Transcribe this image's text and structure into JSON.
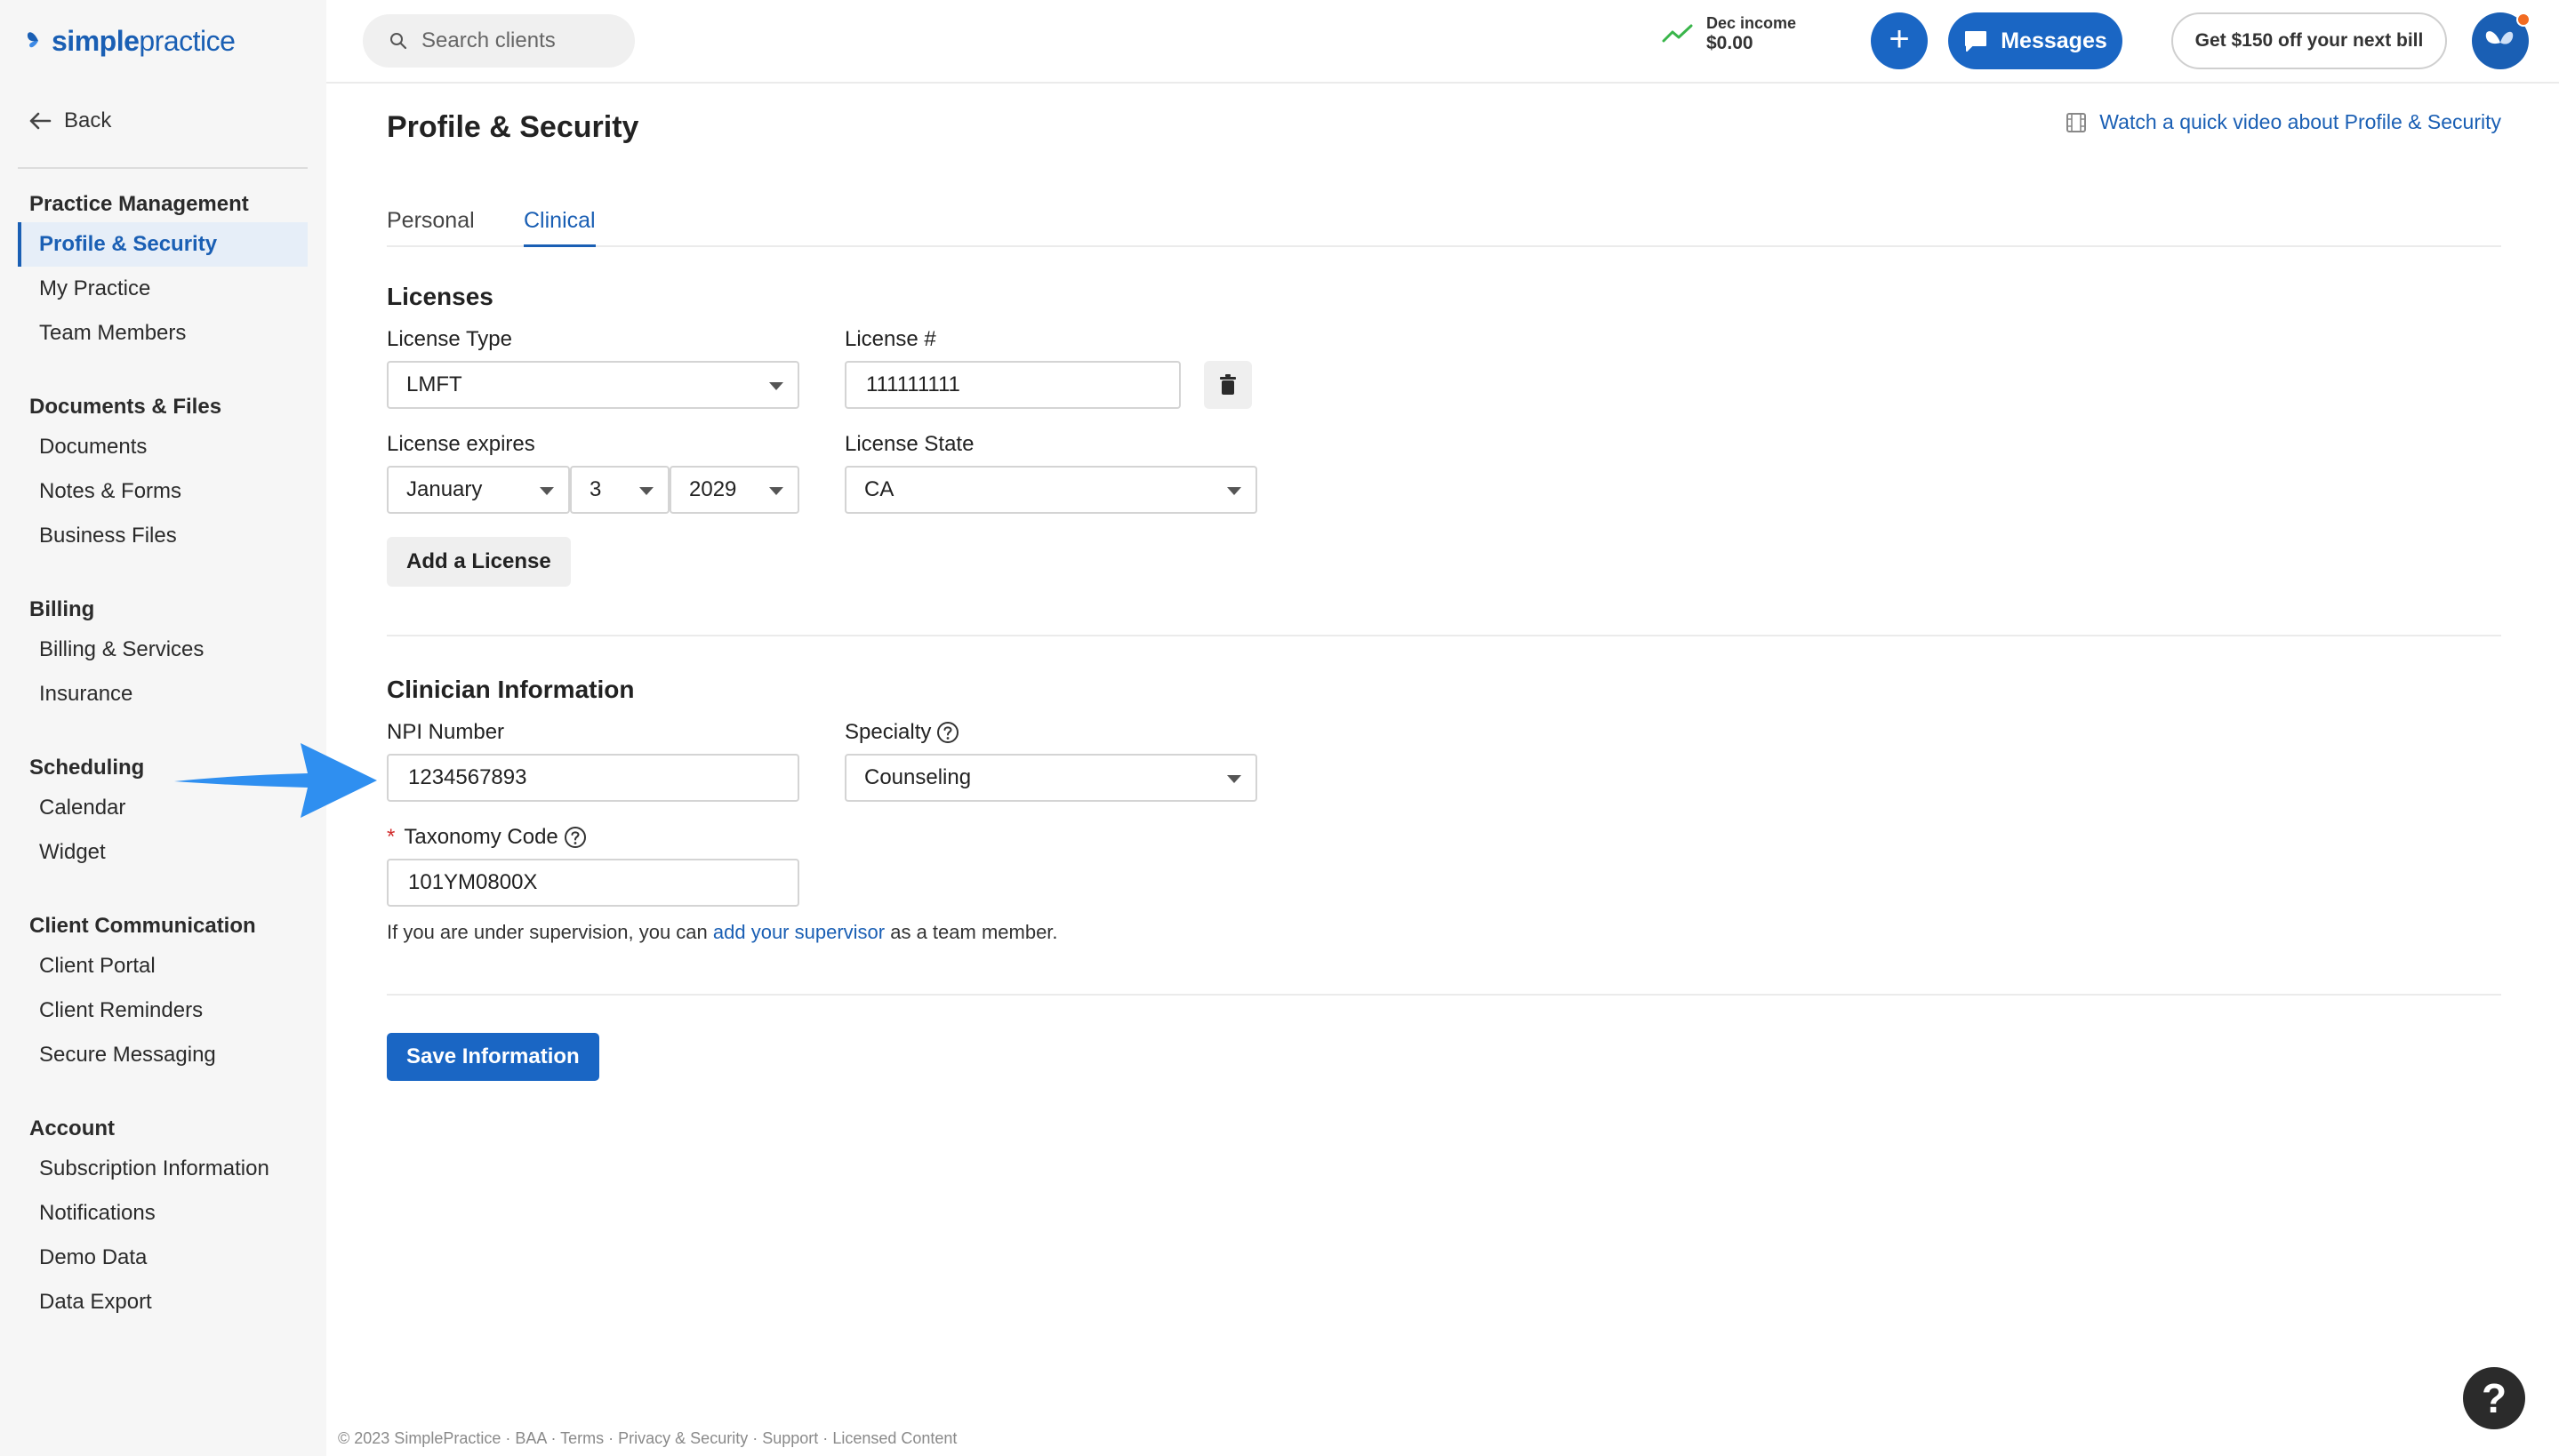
{
  "brand": {
    "name_bold": "simple",
    "name_rest": "practice"
  },
  "sidebar": {
    "back_label": "Back",
    "groups": [
      {
        "title": "Practice Management",
        "items": [
          "Profile & Security",
          "My Practice",
          "Team Members"
        ]
      },
      {
        "title": "Documents & Files",
        "items": [
          "Documents",
          "Notes & Forms",
          "Business Files"
        ]
      },
      {
        "title": "Billing",
        "items": [
          "Billing & Services",
          "Insurance"
        ]
      },
      {
        "title": "Scheduling",
        "items": [
          "Calendar",
          "Widget"
        ]
      },
      {
        "title": "Client Communication",
        "items": [
          "Client Portal",
          "Client Reminders",
          "Secure Messaging"
        ]
      },
      {
        "title": "Account",
        "items": [
          "Subscription Information",
          "Notifications",
          "Demo Data",
          "Data Export"
        ]
      }
    ],
    "active_item": "Profile & Security"
  },
  "topbar": {
    "search_placeholder": "Search clients",
    "income_label": "Dec income",
    "income_value": "$0.00",
    "plus_label": "+",
    "messages_label": "Messages",
    "promo_label": "Get $150 off your next bill"
  },
  "page": {
    "title": "Profile & Security",
    "video_link": "Watch a quick video about Profile & Security",
    "tabs": {
      "personal": "Personal",
      "clinical": "Clinical"
    }
  },
  "licenses": {
    "title": "Licenses",
    "type_label": "License Type",
    "type_value": "LMFT",
    "number_label": "License #",
    "number_value": "111111111",
    "expires_label": "License expires",
    "expires_month": "January",
    "expires_day": "3",
    "expires_year": "2029",
    "state_label": "License State",
    "state_value": "CA",
    "add_button": "Add a License"
  },
  "clinician": {
    "title": "Clinician Information",
    "npi_label": "NPI Number",
    "npi_value": "1234567893",
    "specialty_label": "Specialty",
    "specialty_value": "Counseling",
    "taxonomy_label": "Taxonomy Code",
    "taxonomy_required": "*",
    "taxonomy_value": "101YM0800X",
    "note_before": "If you are under supervision, you can",
    "note_link": "add your supervisor",
    "note_after": "as a team member."
  },
  "save_button": "Save Information",
  "footer": {
    "copyright": "© 2023 SimplePractice",
    "links": [
      "BAA",
      "Terms",
      "Privacy & Security",
      "Support",
      "Licensed Content"
    ],
    "separator": "·"
  },
  "help_label": "?",
  "colors": {
    "accent": "#1a66c4",
    "brand": "#1a5fb4",
    "promo_dot": "#f26b21",
    "arrow": "#2f8ff0"
  }
}
